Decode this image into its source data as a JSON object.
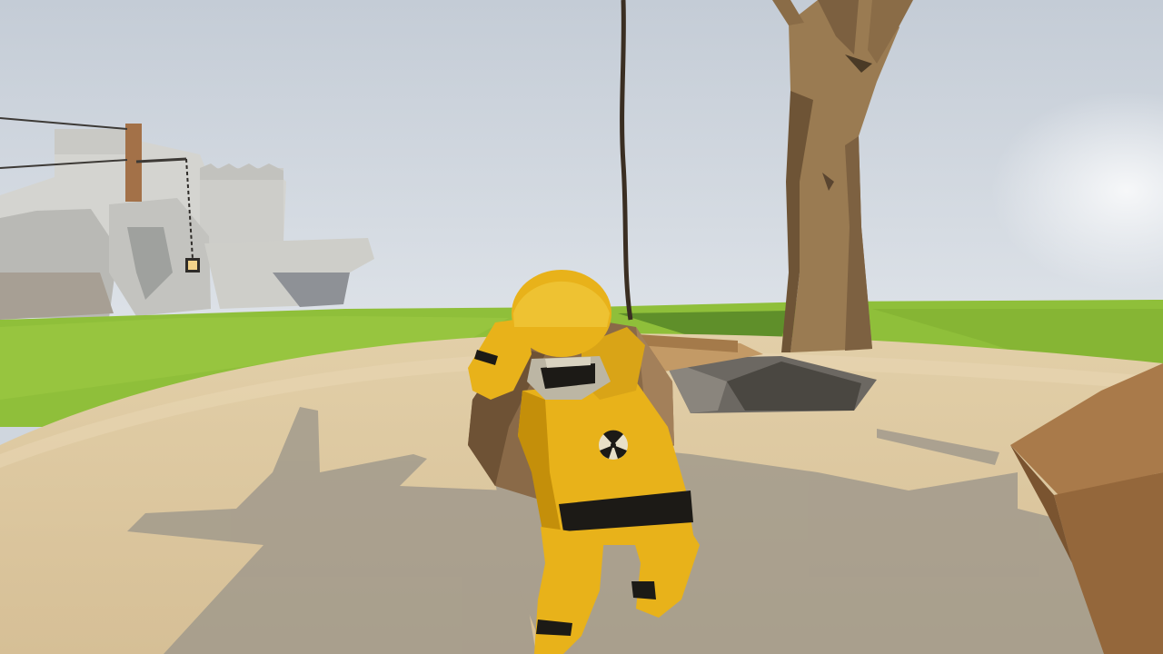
{
  "scene": {
    "colors": {
      "sky_top": "#c4ccd6",
      "sky_bottom": "#dde2e8",
      "grass": "#8fbf3a",
      "grass_shadow": "#5f8f2a",
      "sand": "#dcc59d",
      "sand_light": "#e8d6b2",
      "shadow": "#9a948a",
      "castle": "#d4d4d0",
      "castle_shade": "#a9aaa6",
      "tree": "#9a7b52",
      "tree_dark": "#6e5436",
      "rope": "#3a2e22",
      "boulder": "#8a6a48",
      "character": "#e8b21a",
      "character_dark": "#c48f0a",
      "stripe": "#1c1a16",
      "plank": "#b58a58",
      "crate": "#a97a4a"
    },
    "icons": [
      "castle",
      "tree",
      "rope",
      "boulder",
      "player-character",
      "wooden-plank",
      "pit",
      "wooden-crate",
      "lantern"
    ]
  }
}
